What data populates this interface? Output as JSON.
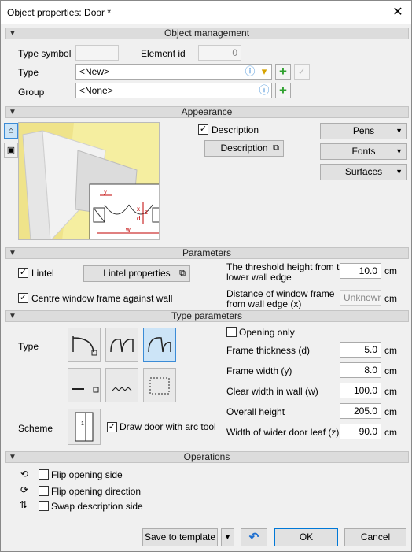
{
  "window": {
    "title": "Object properties: Door *",
    "close_glyph": "✕"
  },
  "sections": {
    "object_management": "Object management",
    "appearance": "Appearance",
    "parameters": "Parameters",
    "type_parameters": "Type parameters",
    "operations": "Operations"
  },
  "object_management": {
    "type_symbol_label": "Type symbol",
    "type_symbol_value": "",
    "element_id_label": "Element id",
    "element_id_value": "0",
    "type_label": "Type",
    "type_value": "<New>",
    "group_label": "Group",
    "group_value": "<None>"
  },
  "appearance": {
    "description_checkbox_label": "Description",
    "description_checked": true,
    "description_button": "Description",
    "pens_button": "Pens",
    "fonts_button": "Fonts",
    "surfaces_button": "Surfaces",
    "preview_labels": {
      "y": "y",
      "x": "x",
      "d": "d",
      "z": "z",
      "w": "w"
    }
  },
  "parameters": {
    "lintel_label": "Lintel",
    "lintel_checked": true,
    "lintel_properties_button": "Lintel properties",
    "centre_window_label": "Centre window frame against wall",
    "centre_window_checked": true,
    "threshold_label_1": "The threshold height from the",
    "threshold_label_2": "lower wall edge",
    "threshold_value": "10.0",
    "threshold_unit": "cm",
    "distance_label_1": "Distance of window frame",
    "distance_label_2": "from wall edge (x)",
    "distance_value": "Unknown>",
    "distance_unit": "cm"
  },
  "type_parameters": {
    "type_label": "Type",
    "scheme_label": "Scheme",
    "scheme_number": "1",
    "draw_arc_label": "Draw door with arc tool",
    "draw_arc_checked": true,
    "opening_only_label": "Opening only",
    "opening_only_checked": false,
    "rows": [
      {
        "label": "Frame thickness (d)",
        "value": "5.0",
        "unit": "cm"
      },
      {
        "label": "Frame width (y)",
        "value": "8.0",
        "unit": "cm"
      },
      {
        "label": "Clear width in wall (w)",
        "value": "100.0",
        "unit": "cm"
      },
      {
        "label": "Overall height",
        "value": "205.0",
        "unit": "cm"
      },
      {
        "label": "Width of wider door leaf (z)",
        "value": "90.0",
        "unit": "cm"
      }
    ]
  },
  "operations": {
    "flip_side_label": "Flip opening side",
    "flip_direction_label": "Flip opening direction",
    "swap_description_label": "Swap description side"
  },
  "footer": {
    "save_template": "Save to template",
    "ok": "OK",
    "cancel": "Cancel"
  },
  "colors": {
    "accent": "#0078d7",
    "add_green": "#2ea02e",
    "preview_yellow": "#f5eea0",
    "dim_red": "#c00000"
  }
}
